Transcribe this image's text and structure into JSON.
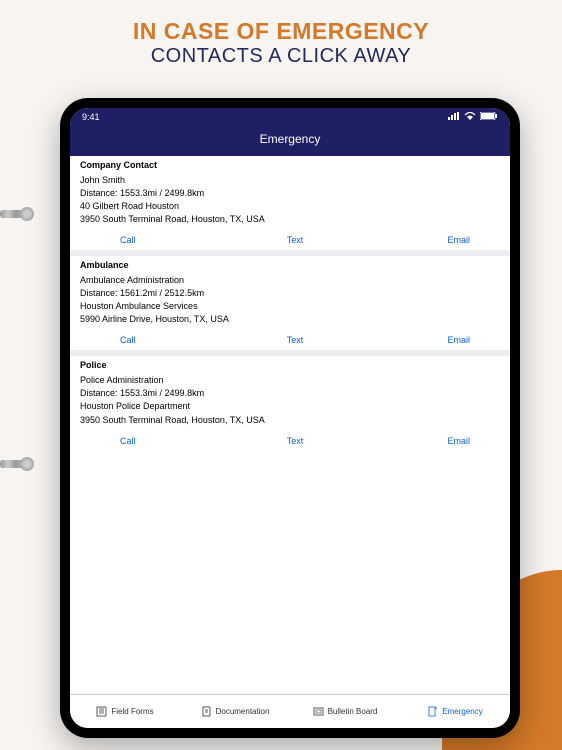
{
  "marketing": {
    "line1": "IN CASE OF EMERGENCY",
    "line2": "CONTACTS A CLICK AWAY"
  },
  "statusBar": {
    "time": "9:41"
  },
  "header": {
    "title": "Emergency"
  },
  "sections": [
    {
      "title": "Company Contact",
      "name": "John Smith",
      "distance": "Distance: 1553.3mi / 2499.8km",
      "org": "40 Gilbert Road Houston",
      "address": "3950 South Terminal Road, Houston, TX, USA"
    },
    {
      "title": "Ambulance",
      "name": "Ambulance Administration",
      "distance": "Distance: 1561.2mi / 2512.5km",
      "org": "Houston Ambulance Services",
      "address": "5990 Airline Drive, Houston, TX, USA"
    },
    {
      "title": "Police",
      "name": "Police Administration",
      "distance": "Distance: 1553.3mi / 2499.8km",
      "org": "Houston Police Department",
      "address": "3950 South Terminal Road, Houston, TX, USA"
    }
  ],
  "actions": {
    "call": "Call",
    "text": "Text",
    "email": "Email"
  },
  "bottomNav": {
    "tabs": [
      {
        "label": "Field Forms"
      },
      {
        "label": "Documentation"
      },
      {
        "label": "Bulletin Board"
      },
      {
        "label": "Emergency"
      }
    ]
  }
}
